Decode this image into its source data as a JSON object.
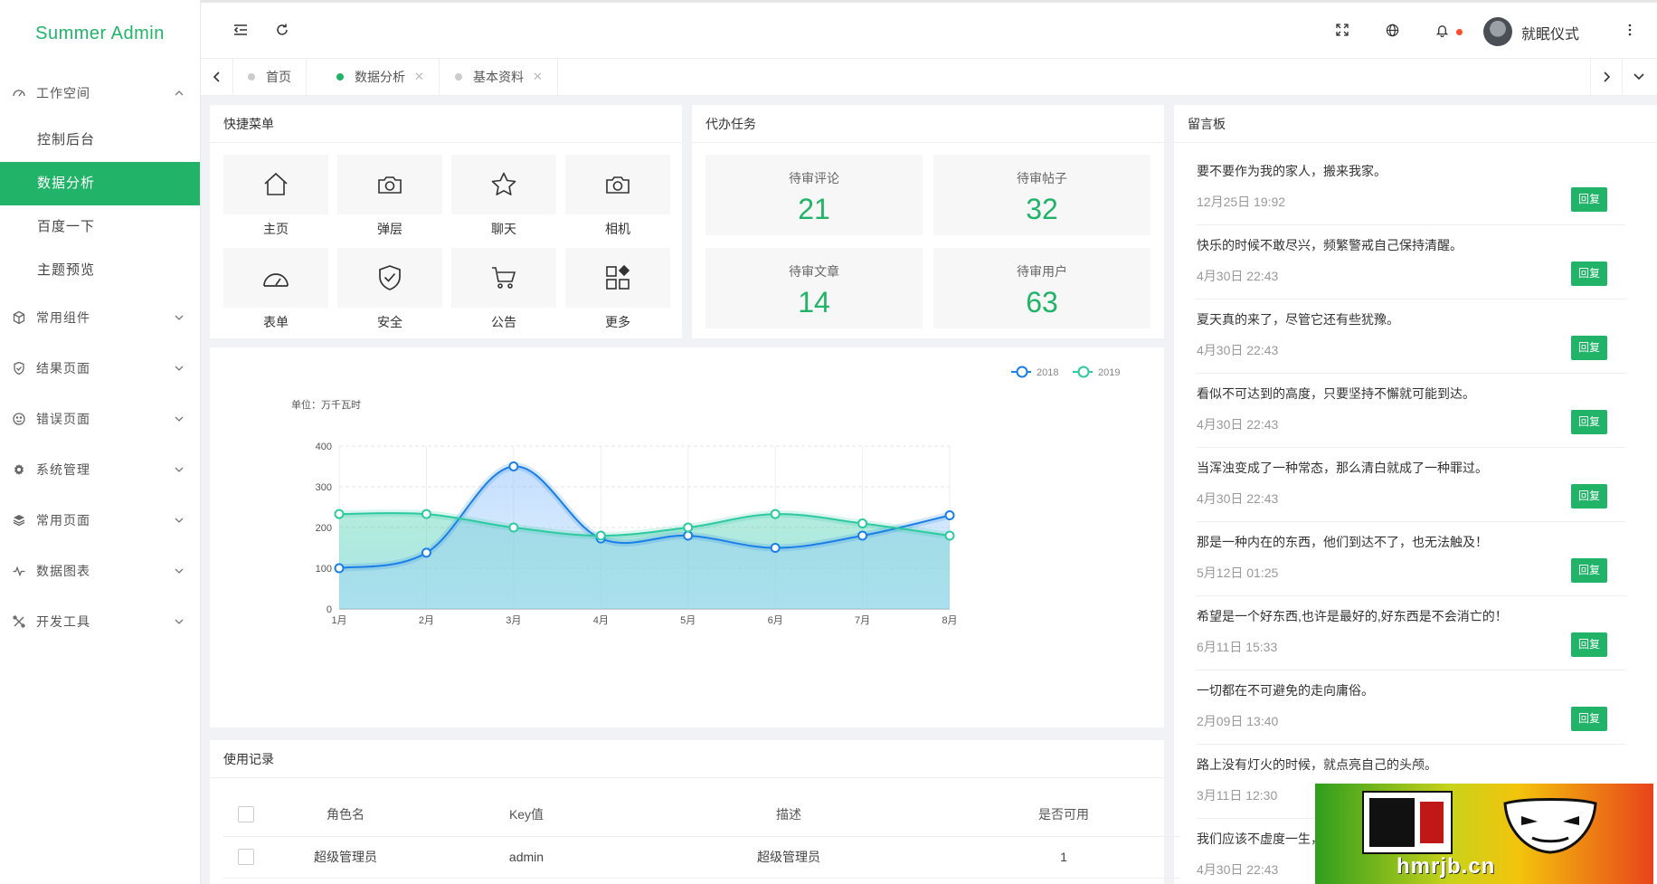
{
  "app": {
    "title": "Summer Admin"
  },
  "sidebar": {
    "groups": [
      {
        "label": "工作空间",
        "icon": "dashboard-icon",
        "expanded": true
      },
      {
        "label": "常用组件",
        "icon": "cube-icon"
      },
      {
        "label": "结果页面",
        "icon": "shield-check-icon"
      },
      {
        "label": "错误页面",
        "icon": "smile-icon"
      },
      {
        "label": "系统管理",
        "icon": "gear-icon"
      },
      {
        "label": "常用页面",
        "icon": "layers-icon"
      },
      {
        "label": "数据图表",
        "icon": "pulse-icon"
      },
      {
        "label": "开发工具",
        "icon": "tools-icon"
      }
    ],
    "subitems": [
      {
        "label": "控制后台"
      },
      {
        "label": "数据分析",
        "active": true
      },
      {
        "label": "百度一下"
      },
      {
        "label": "主题预览"
      }
    ]
  },
  "header": {
    "user_name": "就眠仪式"
  },
  "tabs": [
    {
      "label": "首页"
    },
    {
      "label": "数据分析",
      "active": true
    },
    {
      "label": "基本资料"
    }
  ],
  "quick_menu": {
    "title": "快捷菜单",
    "items": [
      {
        "label": "主页",
        "icon": "home-icon"
      },
      {
        "label": "弹层",
        "icon": "camera-icon"
      },
      {
        "label": "聊天",
        "icon": "star-icon"
      },
      {
        "label": "相机",
        "icon": "camera-icon"
      },
      {
        "label": "表单",
        "icon": "gauge-icon"
      },
      {
        "label": "安全",
        "icon": "shield-check-icon"
      },
      {
        "label": "公告",
        "icon": "cart-icon"
      },
      {
        "label": "更多",
        "icon": "apps-icon"
      }
    ]
  },
  "tasks": {
    "title": "代办任务",
    "items": [
      {
        "label": "待审评论",
        "value": "21"
      },
      {
        "label": "待审帖子",
        "value": "32"
      },
      {
        "label": "待审文章",
        "value": "14"
      },
      {
        "label": "待审用户",
        "value": "63"
      }
    ]
  },
  "chart_data": {
    "type": "area",
    "unit_label": "单位：万千瓦时",
    "categories": [
      "1月",
      "2月",
      "3月",
      "4月",
      "5月",
      "6月",
      "7月",
      "8月"
    ],
    "series": [
      {
        "name": "2018",
        "values": [
          100,
          138,
          350,
          173,
          180,
          150,
          180,
          230
        ],
        "color": "#1a7fe6"
      },
      {
        "name": "2019",
        "values": [
          233,
          233,
          200,
          180,
          200,
          233,
          210,
          180
        ],
        "color": "#2dc9a0"
      }
    ],
    "ylim": [
      0,
      400
    ],
    "yticks": [
      "0",
      "100",
      "200",
      "300",
      "400"
    ],
    "legend": "top-right",
    "grid": true,
    "smooth": true
  },
  "messages": {
    "title": "留言板",
    "reply_label": "回复",
    "items": [
      {
        "text": "要不要作为我的家人，搬来我家。",
        "time": "12月25日 19:92"
      },
      {
        "text": "快乐的时候不敢尽兴，频繁警戒自己保持清醒。",
        "time": "4月30日 22:43"
      },
      {
        "text": "夏天真的来了，尽管它还有些犹豫。",
        "time": "4月30日 22:43"
      },
      {
        "text": "看似不可达到的高度，只要坚持不懈就可能到达。",
        "time": "4月30日 22:43"
      },
      {
        "text": "当浑浊变成了一种常态，那么清白就成了一种罪过。",
        "time": "4月30日 22:43"
      },
      {
        "text": "那是一种内在的东西，他们到达不了，也无法触及！",
        "time": "5月12日 01:25"
      },
      {
        "text": "希望是一个好东西,也许是最好的,好东西是不会消亡的！",
        "time": "6月11日 15:33"
      },
      {
        "text": "一切都在不可避免的走向庸俗。",
        "time": "2月09日 13:40"
      },
      {
        "text": "路上没有灯火的时候，就点亮自己的头颅。",
        "time": "3月11日 12:30"
      },
      {
        "text": "我们应该不虚度一生，",
        "time": "4月30日 22:43"
      }
    ]
  },
  "usage": {
    "title": "使用记录",
    "columns": [
      "角色名",
      "Key值",
      "描述",
      "是否可用"
    ],
    "rows": [
      [
        "超级管理员",
        "admin",
        "超级管理员",
        "1"
      ]
    ]
  },
  "watermark": {
    "text": "hmrjb.cn"
  },
  "colors": {
    "accent": "#21b468"
  }
}
